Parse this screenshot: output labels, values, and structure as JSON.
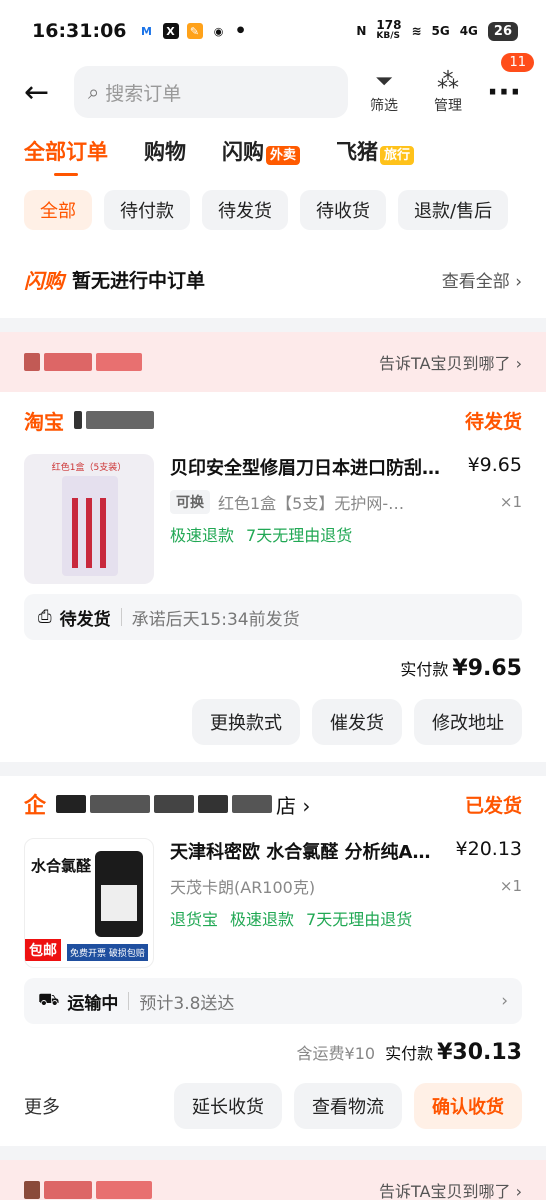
{
  "status_bar": {
    "time": "16:31:06",
    "net_speed": "178",
    "net_unit": "KB/S",
    "signal_a": "5G",
    "signal_b": "4G",
    "battery": "26"
  },
  "header": {
    "search_placeholder": "搜索订单",
    "filter_label": "筛选",
    "manage_label": "管理",
    "more_badge": "11"
  },
  "tabs": [
    {
      "label": "全部订单",
      "tag": ""
    },
    {
      "label": "购物",
      "tag": ""
    },
    {
      "label": "闪购",
      "tag": "外卖"
    },
    {
      "label": "飞猪",
      "tag": "旅行"
    }
  ],
  "filters": [
    "全部",
    "待付款",
    "待发货",
    "待收货",
    "退款/售后"
  ],
  "flash": {
    "logo": "闪购",
    "text": "暂无进行中订单",
    "view_all": "查看全部 ›"
  },
  "tell_bar": {
    "text": "告诉TA宝贝到哪了 ›"
  },
  "order1": {
    "shop_label": "淘宝",
    "status": "待发货",
    "thumb_label": "红色1盒（5支装）",
    "title": "贝印安全型修眉刀日本进口防刮…",
    "price": "¥9.65",
    "tag": "可换",
    "sku": "红色1盒【5支】无护网-…",
    "qty": "×1",
    "perks": [
      "极速退款",
      "7天无理由退货"
    ],
    "ship_label": "待发货",
    "ship_note": "承诺后天15:34前发货",
    "pay_label": "实付款",
    "pay_amount": "¥9.65",
    "buttons": [
      "更换款式",
      "催发货",
      "修改地址"
    ]
  },
  "order2": {
    "shop_icon": "企",
    "shop_suffix": "店 ›",
    "status": "已发货",
    "thumb_title": "水合氯醛",
    "thumb_tag": "包邮",
    "thumb_sub": "免费开票 破损包赔",
    "title": "天津科密欧 水合氯醛 分析纯A…",
    "price": "¥20.13",
    "sku": "天茂卡朗(AR100克)",
    "qty": "×1",
    "perks": [
      "退货宝",
      "极速退款",
      "7天无理由退货"
    ],
    "ship_label": "运输中",
    "ship_note": "预计3.8送达",
    "fee": "含运费¥10",
    "pay_label": "实付款",
    "pay_amount": "¥30.13",
    "more": "更多",
    "buttons": [
      "延长收货",
      "查看物流",
      "确认收货"
    ]
  },
  "tell_bar2": {
    "text": "告诉TA宝贝到哪了 ›"
  }
}
